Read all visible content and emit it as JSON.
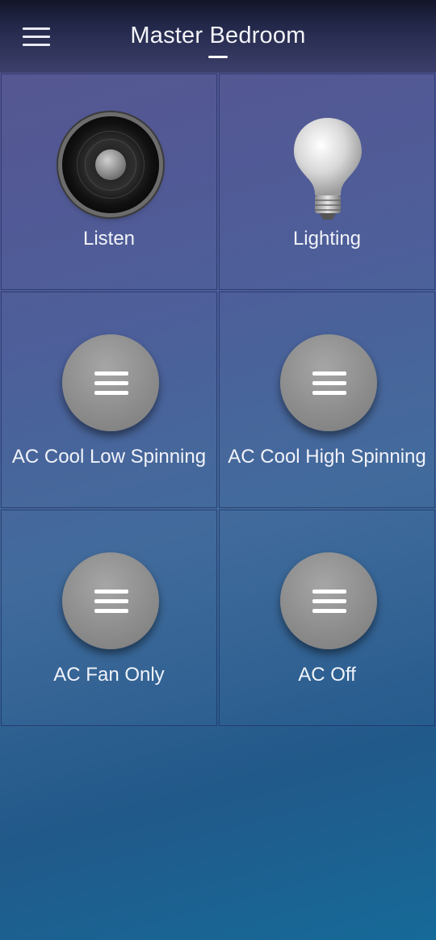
{
  "header": {
    "title": "Master Bedroom"
  },
  "tiles": [
    {
      "label": "Listen",
      "icon": "speaker-icon"
    },
    {
      "label": "Lighting",
      "icon": "light-bulb-icon"
    },
    {
      "label": "AC Cool Low Spinning",
      "icon": "menu-icon"
    },
    {
      "label": "AC Cool High Spinning",
      "icon": "menu-icon"
    },
    {
      "label": "AC Fan Only",
      "icon": "menu-icon"
    },
    {
      "label": "AC Off",
      "icon": "menu-icon"
    }
  ]
}
